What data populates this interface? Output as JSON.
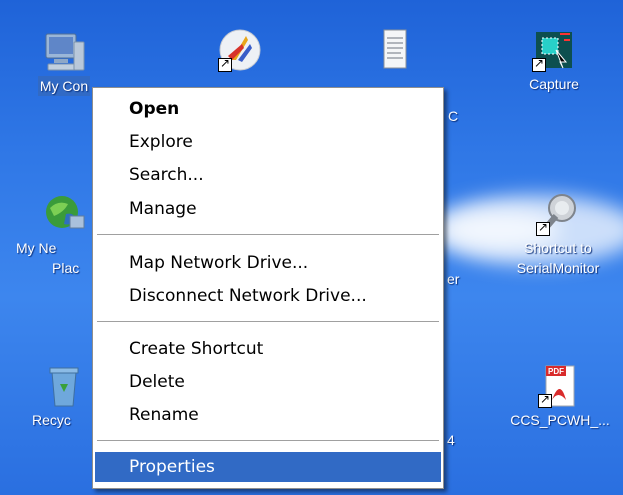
{
  "desktop": {
    "icons": [
      {
        "label": "My Con",
        "selected": true
      },
      {
        "label": "My Ne"
      },
      {
        "label": "Plac"
      },
      {
        "label": "Recyc"
      },
      {
        "label": "C"
      },
      {
        "label": "Capture"
      },
      {
        "label": "er"
      },
      {
        "label": "Shortcut to"
      },
      {
        "label": "SerialMonitor"
      },
      {
        "label": "4"
      },
      {
        "label": "CCS_PCWH_..."
      }
    ]
  },
  "menu": {
    "items": [
      {
        "label": "Open"
      },
      {
        "label": "Explore"
      },
      {
        "label": "Search..."
      },
      {
        "label": "Manage"
      },
      {
        "label": "Map Network Drive..."
      },
      {
        "label": "Disconnect Network Drive..."
      },
      {
        "label": "Create Shortcut"
      },
      {
        "label": "Delete"
      },
      {
        "label": "Rename"
      },
      {
        "label": "Properties"
      }
    ]
  },
  "colors": {
    "desktop": "#2f77e6",
    "highlight": "#316ac5"
  }
}
